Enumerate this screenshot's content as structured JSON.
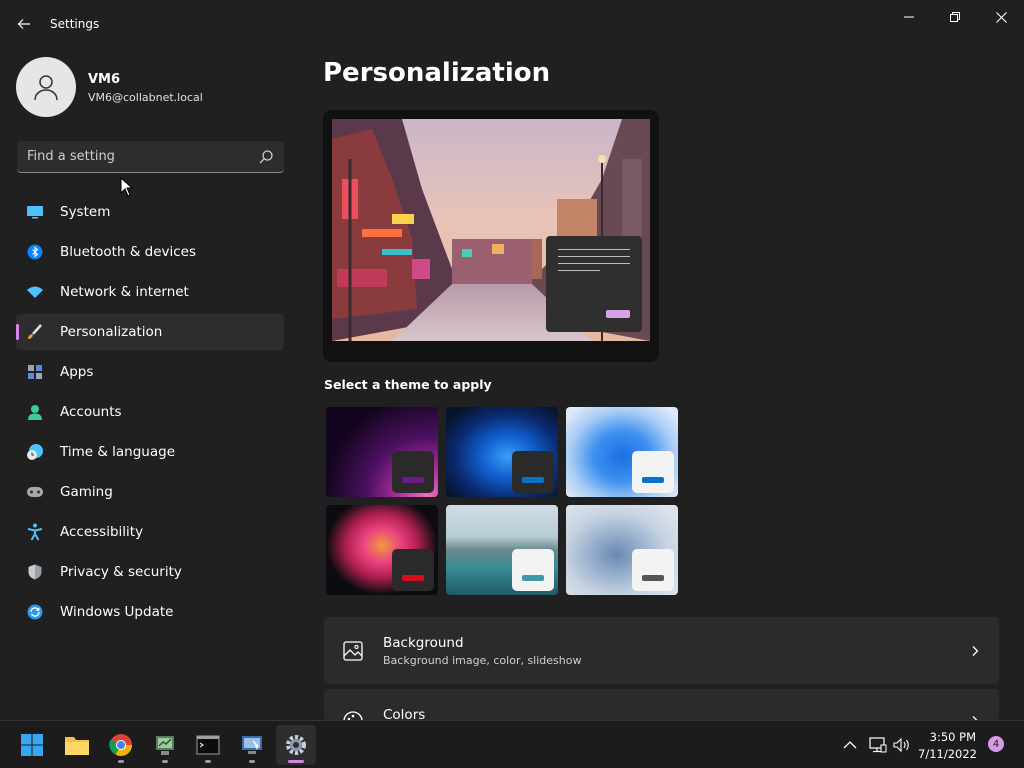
{
  "window": {
    "title": "Settings"
  },
  "profile": {
    "name": "VM6",
    "email": "VM6@collabnet.local"
  },
  "search": {
    "placeholder": "Find a setting"
  },
  "sidebar": {
    "items": [
      {
        "label": "System",
        "icon": "monitor-icon",
        "active": false
      },
      {
        "label": "Bluetooth & devices",
        "icon": "bluetooth-icon",
        "active": false
      },
      {
        "label": "Network & internet",
        "icon": "wifi-icon",
        "active": false
      },
      {
        "label": "Personalization",
        "icon": "paintbrush-icon",
        "active": true
      },
      {
        "label": "Apps",
        "icon": "apps-icon",
        "active": false
      },
      {
        "label": "Accounts",
        "icon": "person-icon",
        "active": false
      },
      {
        "label": "Time & language",
        "icon": "clock-globe-icon",
        "active": false
      },
      {
        "label": "Gaming",
        "icon": "gamepad-icon",
        "active": false
      },
      {
        "label": "Accessibility",
        "icon": "accessibility-icon",
        "active": false
      },
      {
        "label": "Privacy & security",
        "icon": "shield-icon",
        "active": false
      },
      {
        "label": "Windows Update",
        "icon": "update-icon",
        "active": false
      }
    ]
  },
  "main": {
    "title": "Personalization",
    "themes_label": "Select a theme to apply",
    "themes": [
      {
        "name": "glow-dark",
        "chip_bg": "#2a2a2a",
        "accent": "#6a1b8a"
      },
      {
        "name": "bloom-dark",
        "chip_bg": "#2a2a2a",
        "accent": "#0a73c9"
      },
      {
        "name": "bloom-light",
        "chip_bg": "#f3f3f3",
        "accent": "#0a73c9"
      },
      {
        "name": "captured-motion",
        "chip_bg": "#2a2a2a",
        "accent": "#d20f1e"
      },
      {
        "name": "sunrise-lake",
        "chip_bg": "#f3f3f3",
        "accent": "#3f9aa8"
      },
      {
        "name": "flow-light",
        "chip_bg": "#f3f3f3",
        "accent": "#555555"
      }
    ],
    "cards": [
      {
        "title": "Background",
        "subtitle": "Background image, color, slideshow",
        "icon": "image-icon"
      },
      {
        "title": "Colors",
        "subtitle": "",
        "icon": "palette-icon"
      }
    ]
  },
  "taskbar": {
    "apps": [
      {
        "name": "start-button",
        "icon": "windows-logo-icon"
      },
      {
        "name": "file-explorer",
        "icon": "folder-icon"
      },
      {
        "name": "chrome",
        "icon": "chrome-icon"
      },
      {
        "name": "server-manager",
        "icon": "server-icon"
      },
      {
        "name": "terminal",
        "icon": "terminal-icon"
      },
      {
        "name": "remote-desktop",
        "icon": "remote-desktop-icon"
      },
      {
        "name": "settings",
        "icon": "gear-icon"
      }
    ],
    "clock": {
      "time": "3:50 PM",
      "date": "7/11/2022"
    },
    "notification_count": "4"
  },
  "colors": {
    "accent": "#d783e8",
    "background": "#202020",
    "card": "#2b2b2b"
  }
}
